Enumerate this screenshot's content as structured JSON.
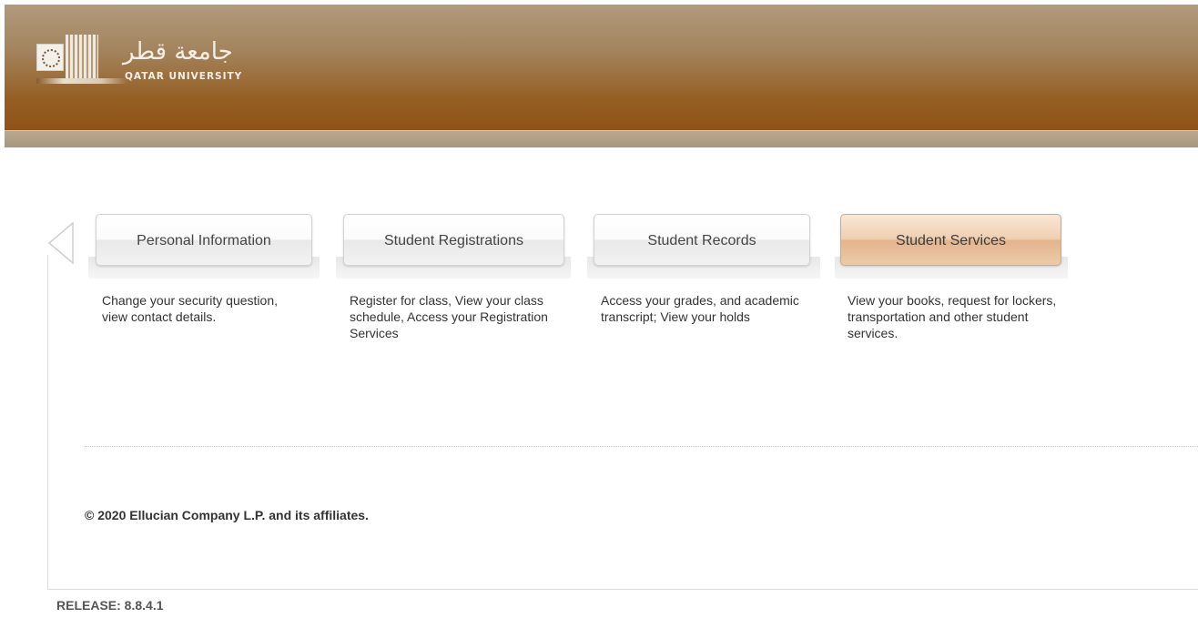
{
  "header": {
    "logo": {
      "arabic_text": "جامعة قطر",
      "latin_text": "QATAR UNIVERSITY"
    },
    "colors": {
      "top": "#b29a7d",
      "bottom": "#8f5216",
      "stripe": "#a8977e"
    }
  },
  "tabs": [
    {
      "label": "Personal Information",
      "description": "Change your security question, view contact details.",
      "active": false
    },
    {
      "label": "Student Registrations",
      "description": "Register for class, View your class schedule, Access your Registration Services",
      "active": false
    },
    {
      "label": "Student Records",
      "description": "Access your grades, and academic transcript; View your holds",
      "active": false
    },
    {
      "label": "Student Services",
      "description": "View your books, request for lockers, transportation and other student services.",
      "active": true
    }
  ],
  "footer": {
    "copyright": "© 2020 Ellucian Company L.P. and its affiliates.",
    "release": "RELEASE: 8.8.4.1"
  },
  "icons": {
    "left_arrow": "chevron-left-icon"
  }
}
